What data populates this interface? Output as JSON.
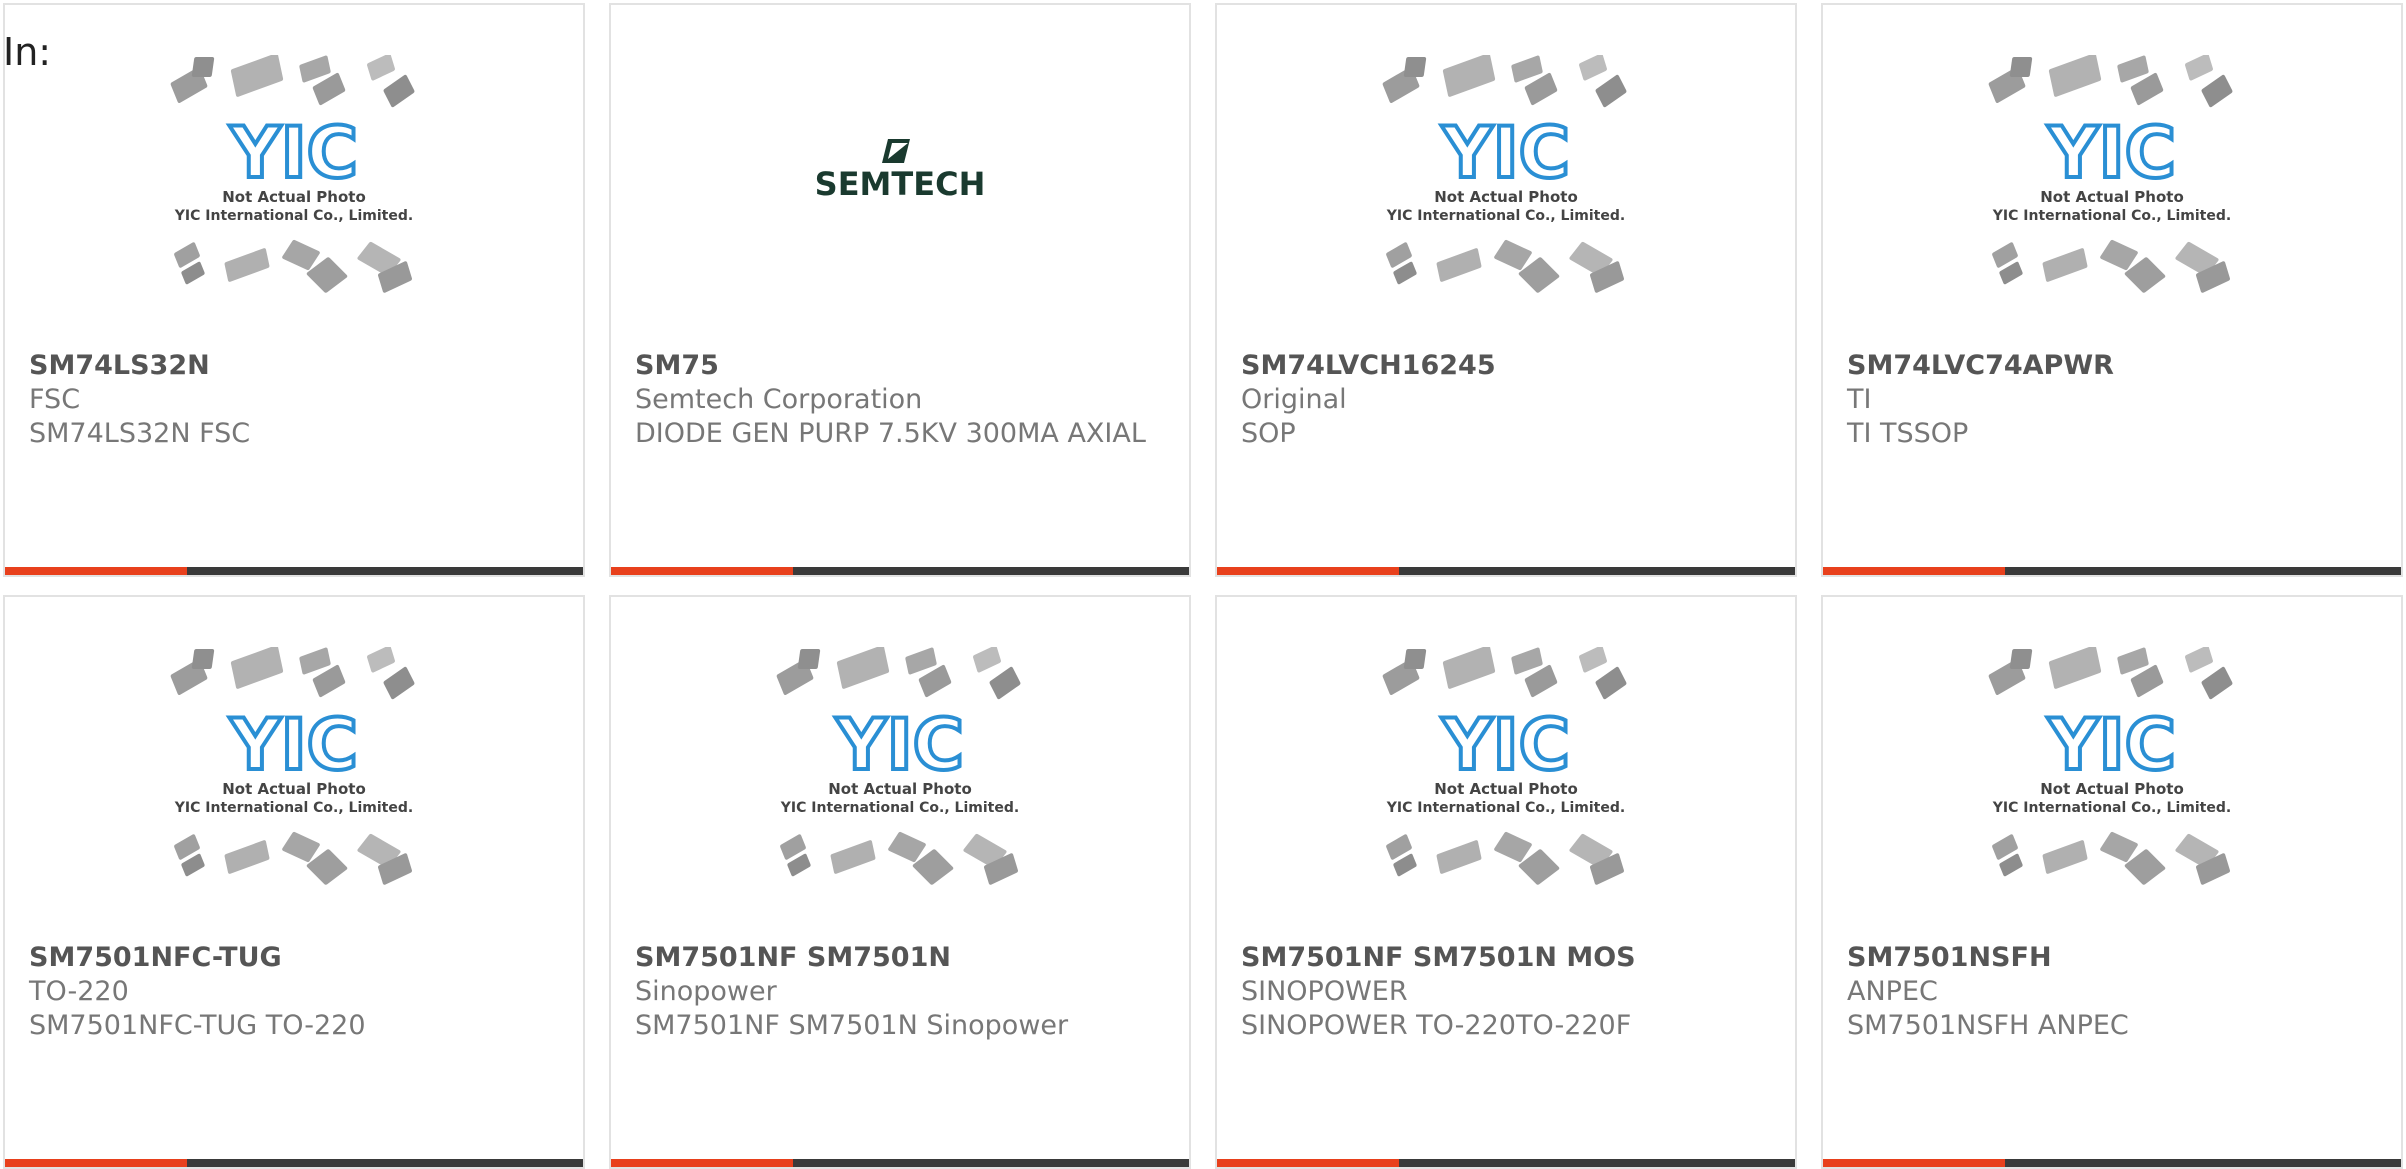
{
  "page": {
    "in_label": "In:",
    "accent_color": "#e8401c",
    "bar_color": "#3a3a3a"
  },
  "placeholder": {
    "line1": "Not Actual Photo",
    "line2": "YIC International Co., Limited.",
    "logo_text": "YIC",
    "logo_color": "#2a8fd4"
  },
  "semtech": {
    "logo_text": "SEMTECH",
    "logo_color": "#1a3a2f"
  },
  "products": [
    {
      "part": "SM74LS32N",
      "maker": "FSC",
      "desc": "SM74LS32N FSC",
      "image": "placeholder"
    },
    {
      "part": "SM75",
      "maker": "Semtech Corporation",
      "desc": "DIODE GEN PURP 7.5KV 300MA AXIAL",
      "image": "semtech-logo"
    },
    {
      "part": "SM74LVCH16245",
      "maker": "Original",
      "desc": "SOP",
      "image": "placeholder"
    },
    {
      "part": "SM74LVC74APWR",
      "maker": "TI",
      "desc": "TI TSSOP",
      "image": "placeholder"
    },
    {
      "part": "SM7501NFC-TUG",
      "maker": "TO-220",
      "desc": "SM7501NFC-TUG TO-220",
      "image": "placeholder"
    },
    {
      "part": "SM7501NF SM7501N",
      "maker": "Sinopower",
      "desc": "SM7501NF SM7501N Sinopower",
      "image": "placeholder"
    },
    {
      "part": "SM7501NF SM7501N MOS",
      "maker": "SINOPOWER",
      "desc": "SINOPOWER TO-220TO-220F",
      "image": "placeholder"
    },
    {
      "part": "SM7501NSFH",
      "maker": "ANPEC",
      "desc": "SM7501NSFH ANPEC",
      "image": "placeholder"
    }
  ]
}
